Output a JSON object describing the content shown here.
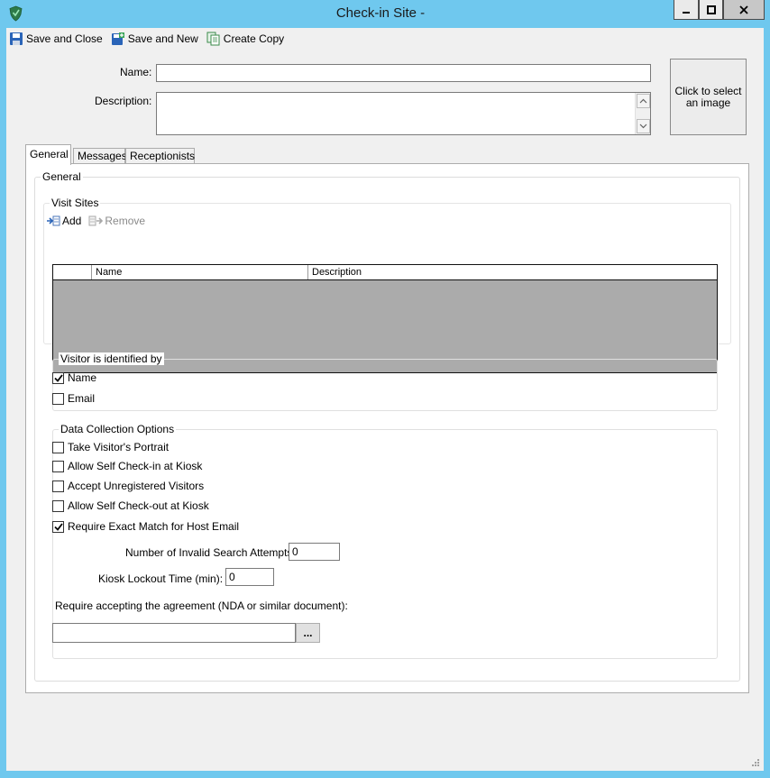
{
  "window": {
    "title": "Check-in Site  -",
    "minimize_glyph": "–",
    "maximize_glyph": "□",
    "close_glyph": "✕"
  },
  "toolbar": {
    "save_close_label": "Save and Close",
    "save_new_label": "Save and New",
    "create_copy_label": "Create Copy"
  },
  "header": {
    "name_label": "Name:",
    "name_value": "",
    "description_label": "Description:",
    "description_value": "",
    "image_placeholder": "Click to select an image"
  },
  "tabs": [
    {
      "label": "General",
      "active": true
    },
    {
      "label": "Messages",
      "active": false
    },
    {
      "label": "Receptionists",
      "active": false
    }
  ],
  "general": {
    "group_title": "General",
    "visit_sites": {
      "title": "Visit Sites",
      "add_label": "Add",
      "remove_label": "Remove",
      "columns": [
        "Name",
        "Description"
      ],
      "rows": []
    },
    "visitor_identified": {
      "title": "Visitor is identified by",
      "options": [
        {
          "label": "Name",
          "checked": true
        },
        {
          "label": "Email",
          "checked": false
        }
      ]
    },
    "data_collection": {
      "title": "Data Collection Options",
      "options": [
        {
          "label": "Take Visitor's Portrait",
          "checked": false
        },
        {
          "label": "Allow Self Check-in at Kiosk",
          "checked": false
        },
        {
          "label": "Accept Unregistered Visitors",
          "checked": false
        },
        {
          "label": "Allow Self Check-out at Kiosk",
          "checked": false
        },
        {
          "label": "Require Exact Match for Host Email",
          "checked": true
        }
      ],
      "invalid_attempts_label": "Number of Invalid Search Attempts:",
      "invalid_attempts_value": "0",
      "lockout_label": "Kiosk Lockout Time (min):",
      "lockout_value": "0",
      "agreement_label": "Require accepting the agreement (NDA or similar document):",
      "agreement_value": "",
      "browse_label": "..."
    }
  },
  "colors": {
    "titlebar": "#6fc8ee",
    "client_bg": "#f0f0f0",
    "grid_empty": "#ababab"
  }
}
